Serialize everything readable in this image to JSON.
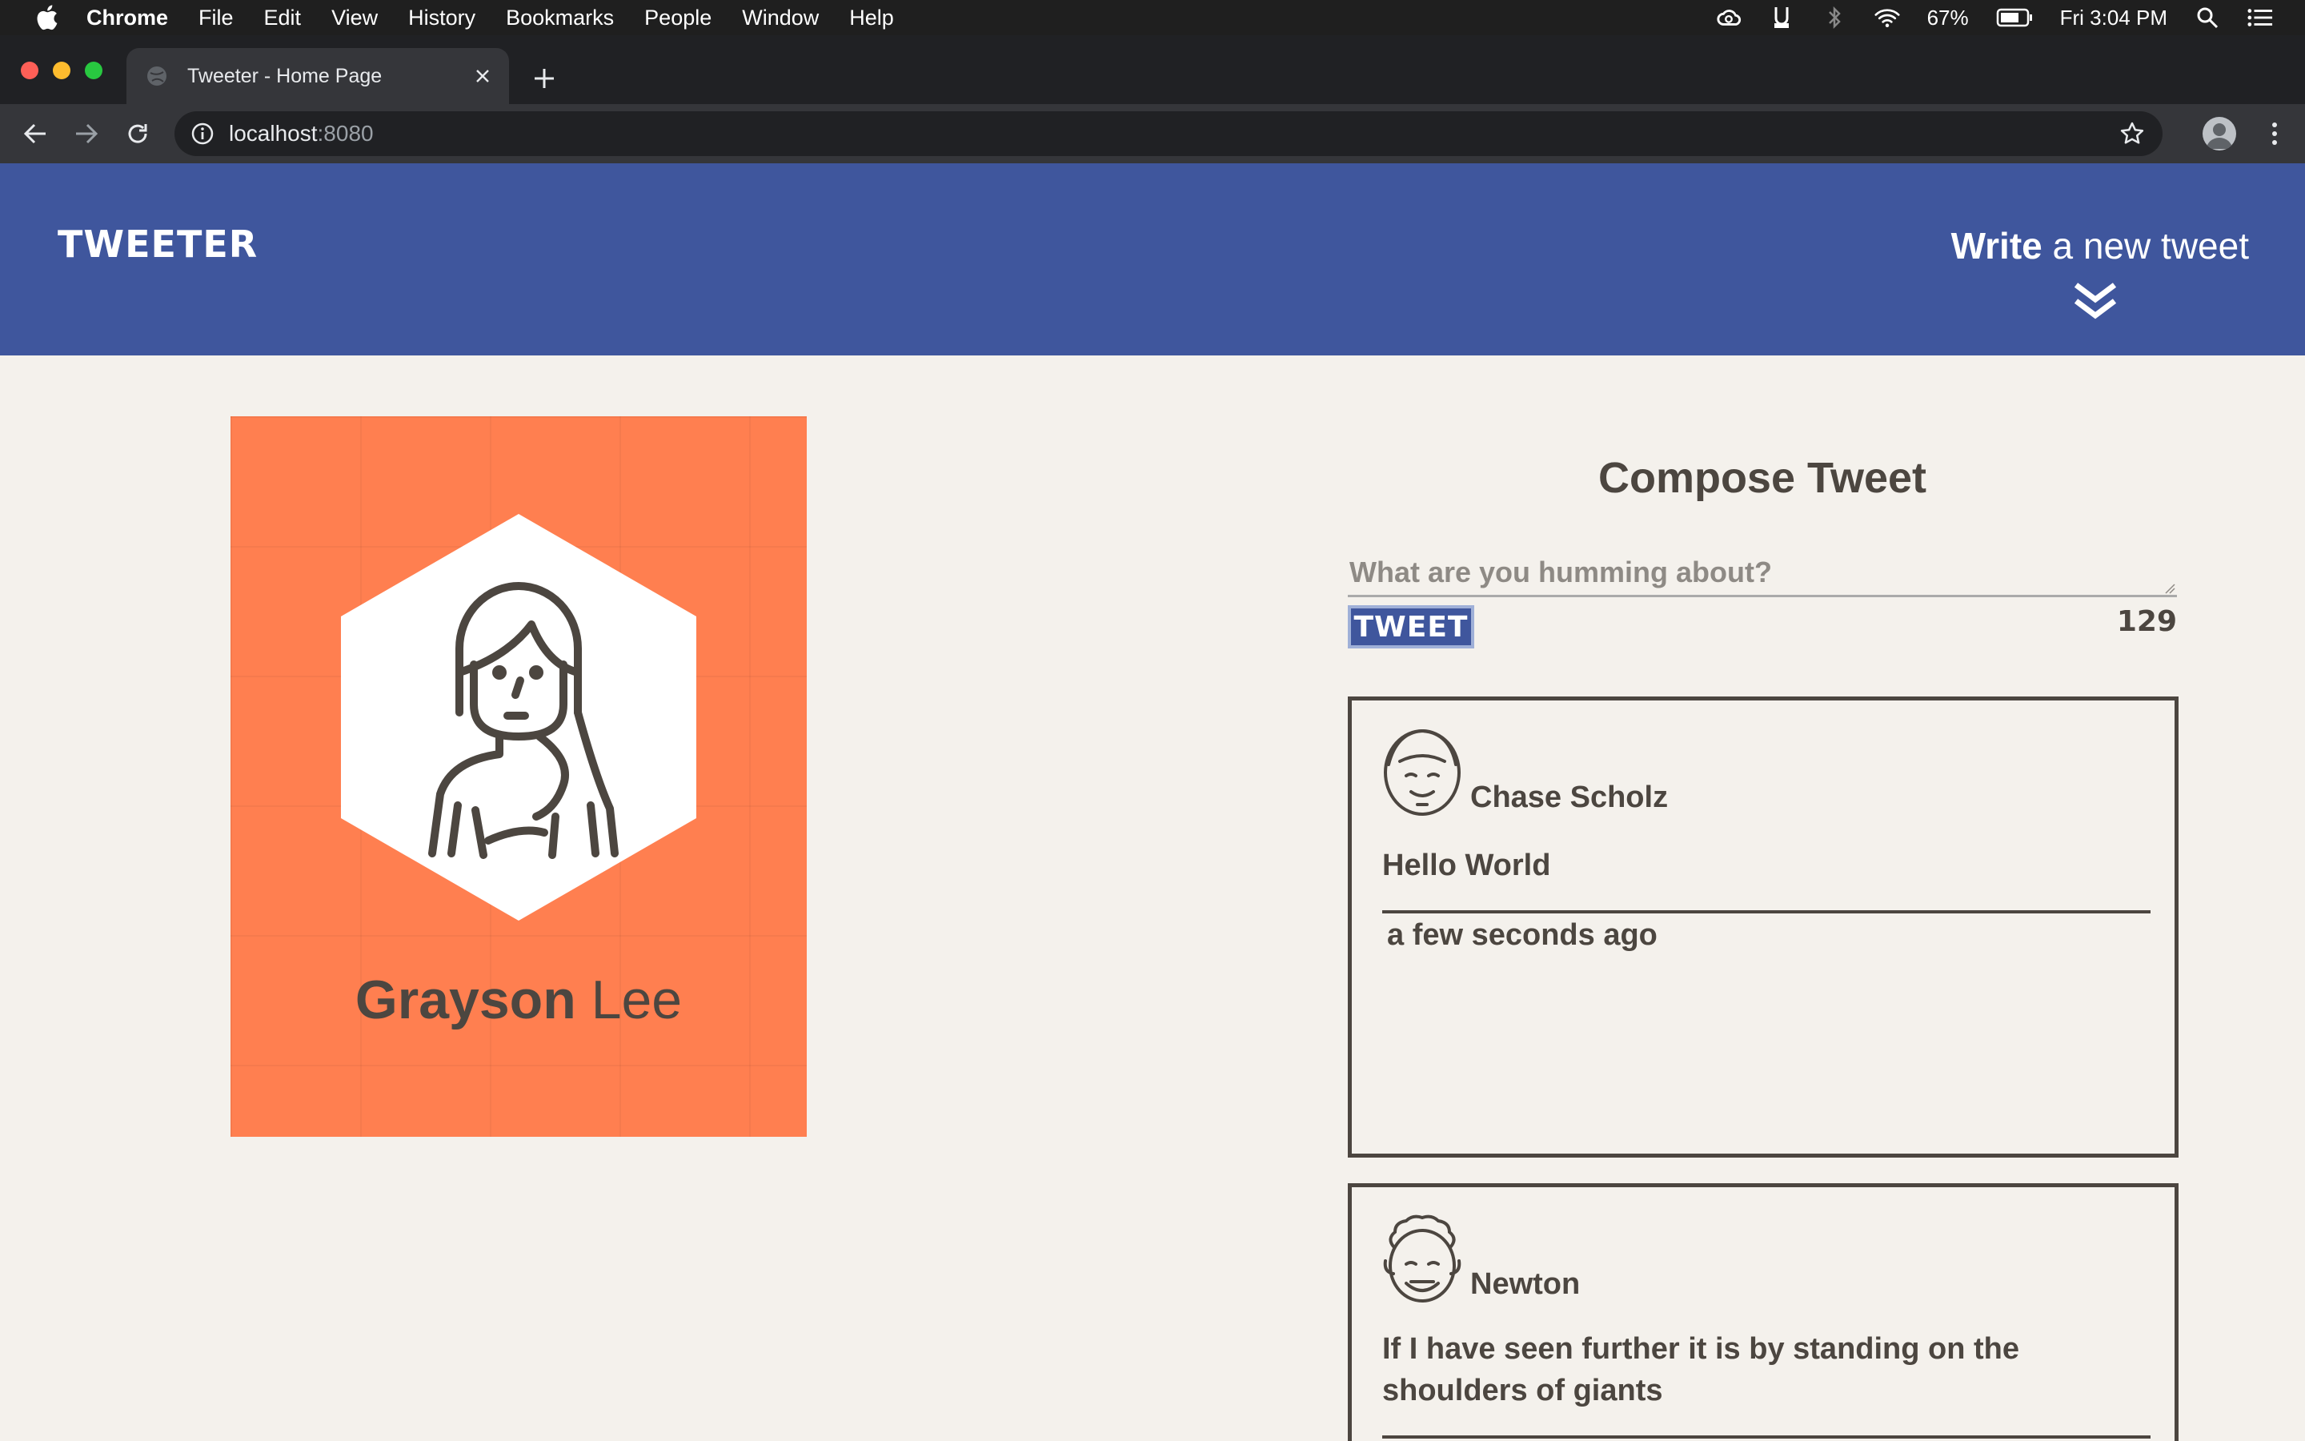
{
  "menubar": {
    "app_name": "Chrome",
    "items": [
      "File",
      "Edit",
      "View",
      "History",
      "Bookmarks",
      "People",
      "Window",
      "Help"
    ],
    "battery": "67%",
    "clock": "Fri 3:04 PM"
  },
  "browser": {
    "tab_title": "Tweeter - Home Page",
    "url_host": "localhost",
    "url_port": ":8080"
  },
  "nav": {
    "brand": "TWEETER",
    "write_strong": "Write",
    "write_rest": " a new tweet"
  },
  "profile": {
    "first_name": "Grayson",
    "last_name": " Lee",
    "card_color": "#ff7f50"
  },
  "compose": {
    "title": "Compose Tweet",
    "placeholder": "What are you humming about?",
    "button_label": "TWEET",
    "counter": "129"
  },
  "tweets": [
    {
      "author": "Chase Scholz",
      "text": "Hello World",
      "time": "a few seconds ago",
      "avatar_icon": "smiling-face-avatar-icon"
    },
    {
      "author": "Newton",
      "text": "If I have seen further it is by standing on the shoulders of giants",
      "time": "",
      "avatar_icon": "curly-hair-face-avatar-icon"
    }
  ],
  "colors": {
    "accent": "#3f569d",
    "text": "#4c4640",
    "background": "#f4f1ec"
  }
}
